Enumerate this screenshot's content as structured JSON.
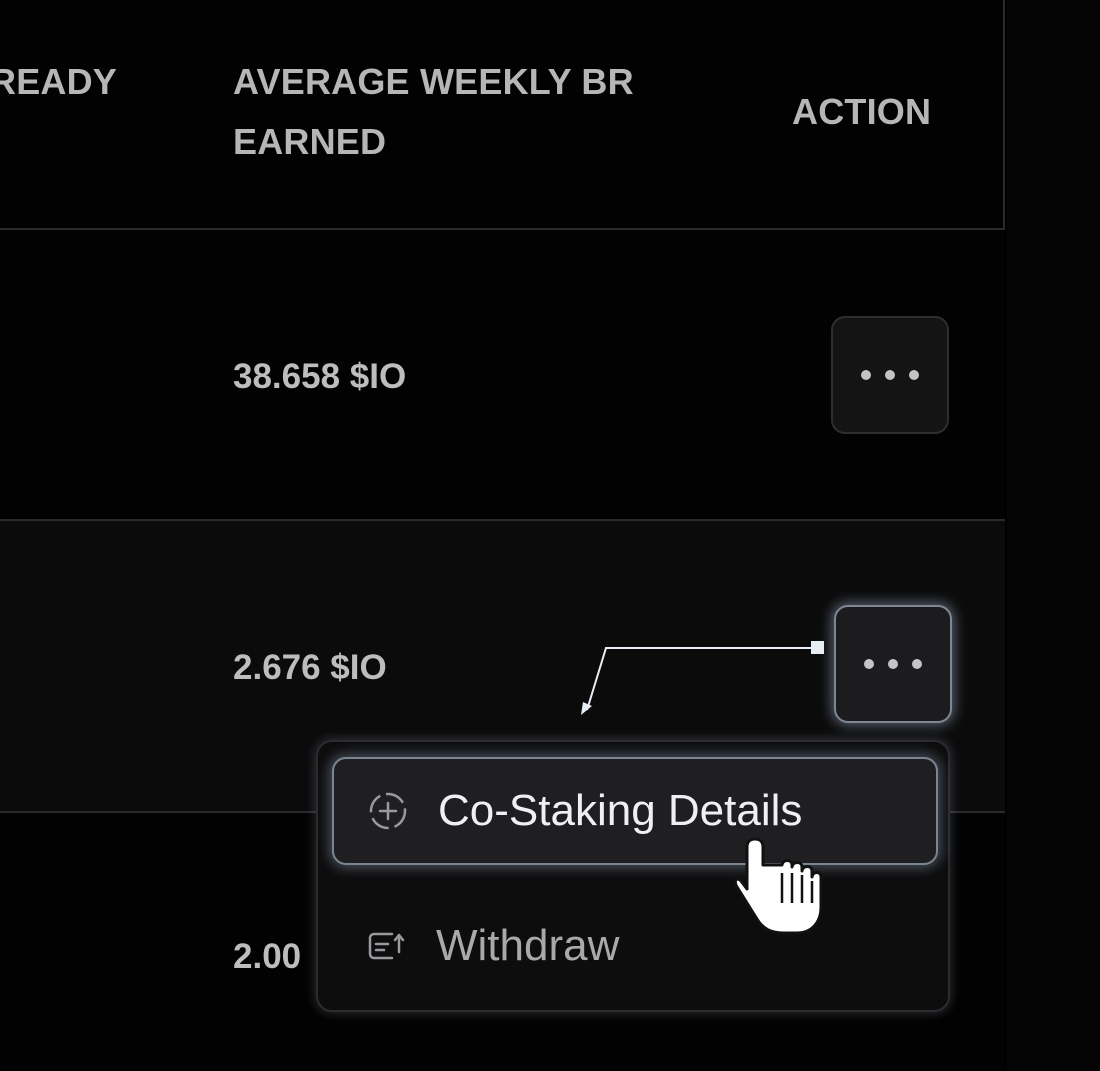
{
  "table": {
    "headers": {
      "ready": "READY",
      "average_weekly": "AVERAGE WEEKLY BR EARNED",
      "action": "ACTION"
    },
    "rows": [
      {
        "average_weekly_br": "38.658 $IO"
      },
      {
        "average_weekly_br": "2.676 $IO"
      },
      {
        "average_weekly_br": "2.00"
      }
    ]
  },
  "dropdown": {
    "items": [
      {
        "label": "Co-Staking Details",
        "icon": "add-circle-icon",
        "state": "hovered"
      },
      {
        "label": "Withdraw",
        "icon": "withdraw-icon",
        "state": "default"
      }
    ]
  },
  "colors": {
    "background": "#000000",
    "border": "#2a2a2c",
    "text": "#bdbdbf",
    "highlight_glow": "#aabed7"
  }
}
